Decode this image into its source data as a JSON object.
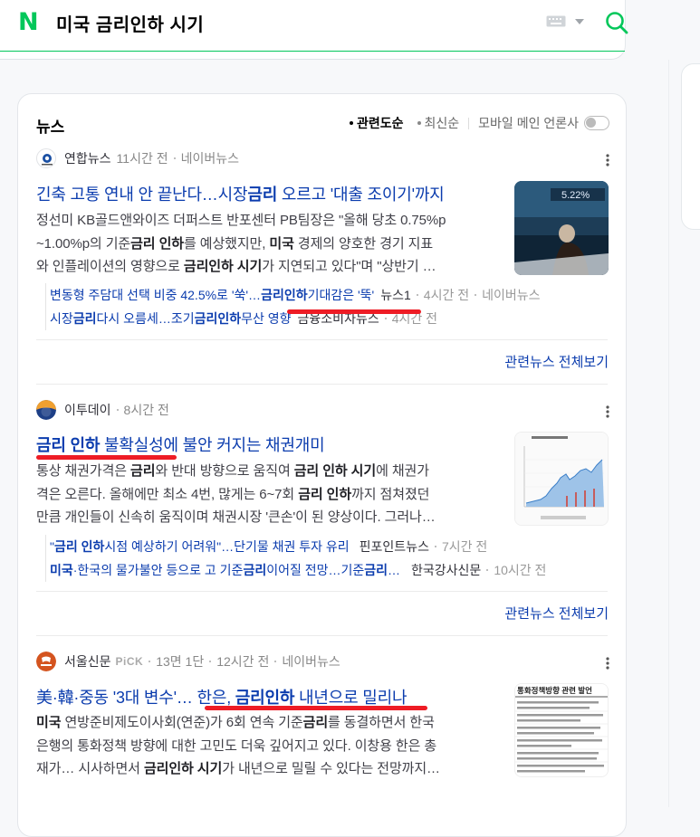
{
  "colors": {
    "brand_green": "#03c75a",
    "link_blue": "#0b3cae",
    "annotation_red": "#ee1c25"
  },
  "header": {
    "logo_letter": "N",
    "query": "미국 금리인하 시기",
    "icons": [
      "keyboard-icon",
      "caret-down-icon",
      "search-icon"
    ]
  },
  "news": {
    "section_title": "뉴스",
    "sort": {
      "relevance": "관련도순",
      "latest": "최신순",
      "mobile_main": "모바일 메인 언론사",
      "mobile_main_enabled": false
    },
    "articles": [
      {
        "press": "연합뉴스",
        "time": "11시간 전",
        "naver_news": "네이버뉴스",
        "title": [
          "긴축 고통 연내 안 끝난다…시장",
          "금리",
          " 오르고 '대출 조이기'까지"
        ],
        "desc": [
          [
            "정선미 KB골드앤와이즈 더퍼스트 반포센터 PB팀장은 \"올해 당초 0.75%p"
          ],
          [
            "~1.00%p의 기준",
            "금리 인하",
            "를 예상했지만, ",
            "미국",
            " 경제의 양호한 경기 지표"
          ],
          [
            "와 인플레이션의 영향으로 ",
            "금리인하 시기",
            "가 지연되고 있다\"며 \"상반기 …"
          ]
        ],
        "thumb_text": "5.22%",
        "related": [
          {
            "parts": [
              "변동형 주담대 선택 비중 42.5%로 '쑥'…",
              "금리인하",
              " 기대감은 '뚝'"
            ],
            "press": "뉴스1",
            "time": "4시간 전",
            "naver": "네이버뉴스"
          },
          {
            "parts": [
              "시장",
              "금리",
              " 다시 오름세…조기 ",
              "금리인하",
              " 무산 영향"
            ],
            "press": "금융소비자뉴스",
            "time": "4시간 전"
          }
        ],
        "related_all": "관련뉴스 전체보기"
      },
      {
        "press": "이투데이",
        "time": "8시간 전",
        "title": [
          "금리 인하",
          " 불확실성에 불안 커지는 채권개미"
        ],
        "desc": [
          [
            "통상 채권가격은 ",
            "금리",
            "와 반대 방향으로 움직여 ",
            "금리 인하 시기",
            "에 채권가"
          ],
          [
            "격은 오른다. 올해에만 최소 4번, 많게는 6~7회 ",
            "금리 인하",
            "까지 점쳐졌던"
          ],
          [
            "만큼 개인들이 신속히 움직이며 채권시장 '큰손'이 된 양상이다. 그러나…"
          ]
        ],
        "related": [
          {
            "parts": [
              "\"",
              "금리 인하",
              " 시점 예상하기 어려워\"…단기물 채권 투자 유리"
            ],
            "press": "핀포인트뉴스",
            "time": "7시간 전"
          },
          {
            "parts": [
              "미국",
              "·한국의 물가불안 등으로 고 기준",
              "금리",
              " 이어질 전망…기준",
              "금리",
              " …"
            ],
            "press": "한국강사신문",
            "time": "10시간 전"
          }
        ],
        "related_all": "관련뉴스 전체보기"
      },
      {
        "press": "서울신문",
        "pick": "PiCK",
        "badge": "13면 1단",
        "time": "12시간 전",
        "naver_news": "네이버뉴스",
        "title": [
          "美·韓·중동 '3대 변수'… 한은, ",
          "금리인하",
          " 내년으로 밀리나"
        ],
        "desc": [
          [
            "미국",
            " 연방준비제도이사회(연준)가 6회 연속 기준",
            "금리",
            "를 동결하면서 한국"
          ],
          [
            "은행의 통화정책 방향에 대한 고민도 더욱 깊어지고 있다. 이창용 한은 총"
          ],
          [
            "재가… 시사하면서 ",
            "금리인하 시기",
            "가 내년으로 밀릴 수 있다는 전망까지…"
          ]
        ],
        "thumb_text": "통화정책방향 관련 발언"
      }
    ]
  }
}
